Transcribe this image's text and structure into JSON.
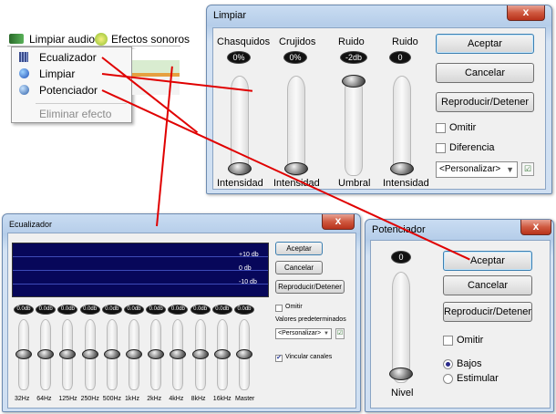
{
  "menubar": {
    "limpiar_audio": "Limpiar audio",
    "efectos_sonoros": "Efectos sonoros"
  },
  "menu": {
    "items": [
      "Ecualizador",
      "Limpiar",
      "Potenciador",
      "Eliminar efecto"
    ]
  },
  "limpiar": {
    "title": "Limpiar",
    "close": "x",
    "columns": [
      {
        "header": "Chasquidos",
        "value": "0%",
        "footer": "Intensidad"
      },
      {
        "header": "Crujidos",
        "value": "0%",
        "footer": "Intensidad"
      },
      {
        "header": "Ruido",
        "value": "-2db",
        "footer": "Umbral"
      },
      {
        "header": "Ruido",
        "value": "0",
        "footer": "Intensidad"
      }
    ],
    "buttons": {
      "accept": "Aceptar",
      "cancel": "Cancelar",
      "play": "Reproducir/Detener"
    },
    "checks": {
      "omit": "Omitir",
      "diff": "Diferencia"
    },
    "preset": "<Personalizar>"
  },
  "ecualizador": {
    "title": "Ecualizador",
    "close": "x",
    "db": [
      "+10 db",
      "0 db",
      "-10 db"
    ],
    "buttons": {
      "accept": "Aceptar",
      "cancel": "Cancelar",
      "play": "Reproducir/Detener"
    },
    "omit": "Omitir",
    "presets_label": "Valores predeterminados",
    "preset": "<Personalizar>",
    "link": "Vincular canales",
    "band_value": "0.0db",
    "bands": [
      "32Hz",
      "64Hz",
      "125Hz",
      "250Hz",
      "500Hz",
      "1kHz",
      "2kHz",
      "4kHz",
      "8kHz",
      "16kHz",
      "Master"
    ]
  },
  "potenciador": {
    "title": "Potenciador",
    "close": "x",
    "value": "0",
    "footer": "Nivel",
    "buttons": {
      "accept": "Aceptar",
      "cancel": "Cancelar",
      "play": "Reproducir/Detener"
    },
    "omit": "Omitir",
    "radios": [
      "Bajos",
      "Estimular"
    ]
  },
  "colors": {
    "accent": "#2a4fd6",
    "callout": "#e00000",
    "eq_display": "#07075a"
  }
}
